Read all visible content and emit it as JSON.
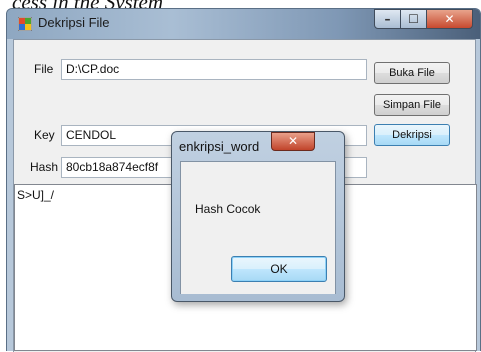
{
  "caption": "cess in the System",
  "window": {
    "title": "Dekripsi File",
    "controls": {
      "minimize": "–",
      "maximize": "☐",
      "close": "✕"
    }
  },
  "form": {
    "file_label": "File",
    "file_value": "D:\\CP.doc",
    "key_label": "Key",
    "key_value": "CENDOL",
    "hash_label": "Hash",
    "hash_value": "80cb18a874ecf8f",
    "output_text": "S>U]_/"
  },
  "buttons": {
    "open_file": "Buka File",
    "save_file": "Simpan File",
    "decrypt": "Dekripsi"
  },
  "dialog": {
    "title": "enkripsi_word",
    "message": "Hash Cocok",
    "ok": "OK",
    "close": "✕"
  },
  "colors": {
    "titlebar": "#8ea7c1",
    "close_red": "#c7492f",
    "focus_blue": "#3c7fb1"
  }
}
